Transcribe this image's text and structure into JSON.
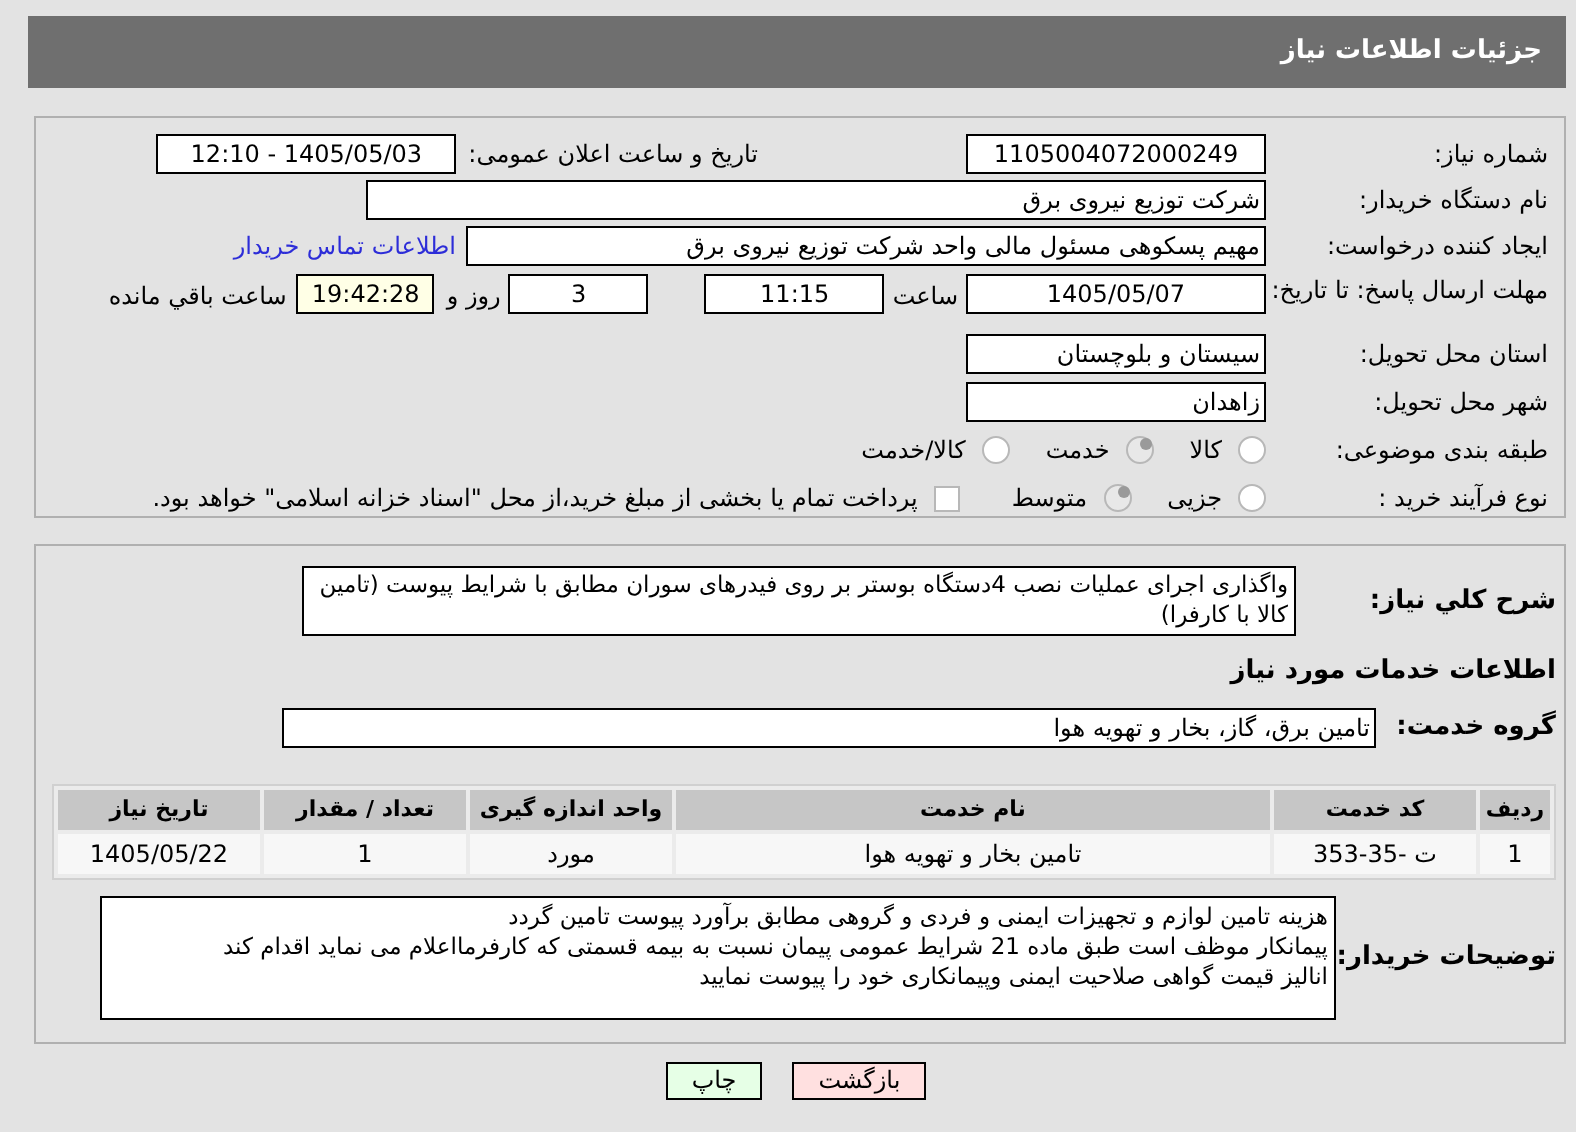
{
  "page_title": "جزئیات اطلاعات نیاز",
  "need_number": {
    "label": "شماره نیاز:",
    "value": "1105004072000249"
  },
  "announce": {
    "label": "تاریخ و ساعت اعلان عمومی:",
    "value": "1405/05/03 - 12:10"
  },
  "buyer": {
    "label": "نام دستگاه خریدار:",
    "value": "شرکت توزیع نیروی برق"
  },
  "creator": {
    "label": "ایجاد کننده درخواست:",
    "value": "مهیم پسکوهی مسئول مالی واحد شرکت توزیع نیروی برق"
  },
  "contact_link": "اطلاعات تماس خریدار",
  "deadline": {
    "label": "مهلت ارسال پاسخ: تا تاریخ:",
    "date": "1405/05/07",
    "time_label": "ساعت",
    "time": "11:15",
    "days": "3",
    "days_label": "روز و",
    "remaining": "19:42:28",
    "remaining_label": "ساعت باقي مانده"
  },
  "province": {
    "label": "استان محل تحویل:",
    "value": "سیستان و بلوچستان"
  },
  "city": {
    "label": "شهر محل تحویل:",
    "value": "زاهدان"
  },
  "category": {
    "label": "طبقه بندی موضوعی:",
    "options": [
      {
        "label": "کالا",
        "selected": false
      },
      {
        "label": "خدمت",
        "selected": true
      },
      {
        "label": "کالا/خدمت",
        "selected": false
      }
    ]
  },
  "process": {
    "label": "نوع فرآیند خرید :",
    "options": [
      {
        "label": "جزیی",
        "selected": false
      },
      {
        "label": "متوسط",
        "selected": true
      }
    ],
    "payment": {
      "checked": false,
      "text": "پرداخت تمام یا بخشی از مبلغ خرید،از محل \"اسناد خزانه اسلامی\" خواهد بود."
    }
  },
  "summary": {
    "label": "شرح كلي نياز:",
    "value": "واگذاری اجرای عملیات نصب 4دستگاه بوستر بر روی فیدرهای سوران مطابق با شرایط پیوست (تامین کالا با کارفرا)"
  },
  "services_heading": "اطلاعات خدمات مورد نیاز",
  "service_group": {
    "label": "گروه خدمت:",
    "value": "تامین برق، گاز، بخار و تهویه هوا"
  },
  "table": {
    "columns": [
      "ردیف",
      "کد خدمت",
      "نام خدمت",
      "واحد اندازه گیری",
      "تعداد / مقدار",
      "تاریخ نیاز"
    ],
    "rows": [
      [
        "1",
        "ت -35-353",
        "تامین بخار و تهویه هوا",
        "مورد",
        "1",
        "1405/05/22"
      ]
    ]
  },
  "buyer_notes": {
    "label": "توضیحات خریدار:",
    "value": "هزینه تامین لوازم و تجهیزات ایمنی و فردی و گروهی مطابق برآورد پیوست تامین گردد\nپیمانکار موظف  است طبق ماده 21 شرایط عمومی پیمان نسبت به بیمه قسمتی که کارفرمااعلام می نماید اقدام کند\nانالیز قیمت گواهی صلاحیت ایمنی وپیمانکاری خود را پیوست نمایید"
  },
  "buttons": [
    {
      "label": "بازگشت",
      "kind": "back"
    },
    {
      "label": "چاپ",
      "kind": "print"
    }
  ]
}
